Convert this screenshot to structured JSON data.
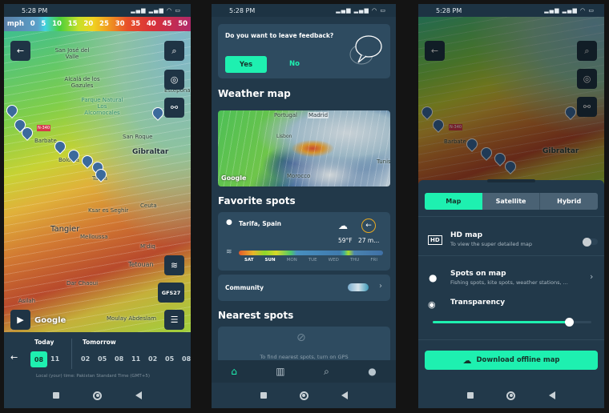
{
  "status_time": "5:28 PM",
  "left": {
    "scale_labels": [
      "mph",
      "0",
      "5",
      "10",
      "15",
      "20",
      "25",
      "30",
      "35",
      "40",
      "45",
      "50"
    ],
    "map_labels": [
      "San José del Valle",
      "Alcalá de los Gazules",
      "Parque Natural Los Alcornocales",
      "Barbate",
      "Bolonia",
      "Tarifa",
      "San Roque",
      "Gibraltar",
      "Estepona",
      "Ksar es Seghir",
      "Tangier",
      "Melloussa",
      "Ceuta",
      "M'diq",
      "Tetouan",
      "Dar Chaoui",
      "Asilah",
      "Moulay Abdeslam",
      "N-340"
    ],
    "model_button": "GFS27",
    "google": "Google",
    "timeline": {
      "today": "Today",
      "tomorrow": "Tomorrow",
      "today_hours": [
        "08",
        "11"
      ],
      "selected": "08",
      "tomorrow_hours": [
        "02",
        "05",
        "08",
        "11",
        "02",
        "05",
        "08"
      ],
      "timezone": "Local (your) time: Pakistan Standard Time (GMT+5)"
    }
  },
  "middle": {
    "feedback": {
      "question": "Do you want to leave feedback?",
      "yes": "Yes",
      "no": "No"
    },
    "weather_map_title": "Weather map",
    "map_labels": [
      "Portugal",
      "Madrid",
      "Lisbon",
      "Morocco",
      "Tunis"
    ],
    "google": "Google",
    "favorite_title": "Favorite spots",
    "spot": {
      "name": "Tarifa, Spain",
      "temp": "59°F",
      "wind": "27 m...",
      "days": [
        "SAT",
        "SUN",
        "MON",
        "TUE",
        "WED",
        "THU",
        "FRI"
      ]
    },
    "community": "Community",
    "nearest_title": "Nearest spots",
    "nearest_hint": "To find nearest spots, turn on GPS",
    "nav": [
      "home",
      "map",
      "search",
      "profile"
    ]
  },
  "right": {
    "map_labels": [
      "Barbate",
      "Gibraltar",
      "N-340"
    ],
    "tabs": [
      "Map",
      "Satellite",
      "Hybrid"
    ],
    "selected_tab": "Map",
    "hd": {
      "title": "HD map",
      "subtitle": "To view the super detailed map",
      "enabled": false
    },
    "spots": {
      "title": "Spots on map",
      "subtitle": "Fishing spots, kite spots, weather stations, ..."
    },
    "transparency": {
      "title": "Transparency",
      "value": 0.86
    },
    "download": "Download offline map"
  },
  "colors": {
    "accent": "#1ef0b0",
    "panel": "#22394a",
    "card": "#2e4b60",
    "highlight_ring": "#e8a920"
  }
}
